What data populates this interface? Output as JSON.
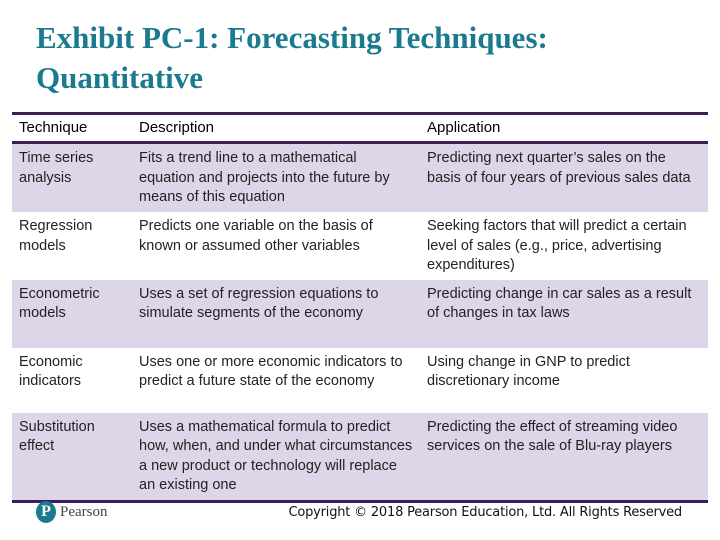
{
  "slide": {
    "title": "Exhibit PC-1: Forecasting Techniques: Quantitative"
  },
  "table": {
    "headers": [
      "Technique",
      "Description",
      "Application"
    ],
    "rows": [
      {
        "technique": "Time series analysis",
        "description": "Fits a trend line to a mathematical equation and projects into the future by means of this equation",
        "application": "Predicting next quarter’s sales on the basis of four years of previous sales data"
      },
      {
        "technique": "Regression models",
        "description": "Predicts one variable on the basis of known or assumed other variables",
        "application": "Seeking factors that will predict a certain level of sales (e.g., price, advertising expenditures)"
      },
      {
        "technique": "Econometric models",
        "description": "Uses a set of regression equations to simulate segments of the economy",
        "application": "Predicting change in car sales as a result of changes in tax laws"
      },
      {
        "technique": "Economic indicators",
        "description": "Uses one or more economic indicators to predict a future state of the economy",
        "application": "Using change in GNP to predict discretionary income"
      },
      {
        "technique": "Substitution effect",
        "description": "Uses a mathematical formula to predict how, when, and under what circumstances a new product or technology will replace an existing one",
        "application": "Predicting the effect of streaming video services on the sale of Blu-ray players"
      }
    ]
  },
  "footer": {
    "logo_mark": "P",
    "logo_text": "Pearson",
    "copyright": "Copyright © 2018 Pearson Education, Ltd. All Rights Reserved"
  },
  "colors": {
    "title": "#1a7a8e",
    "rule": "#3b1f5a",
    "row_shade": "#dcd6e8"
  }
}
